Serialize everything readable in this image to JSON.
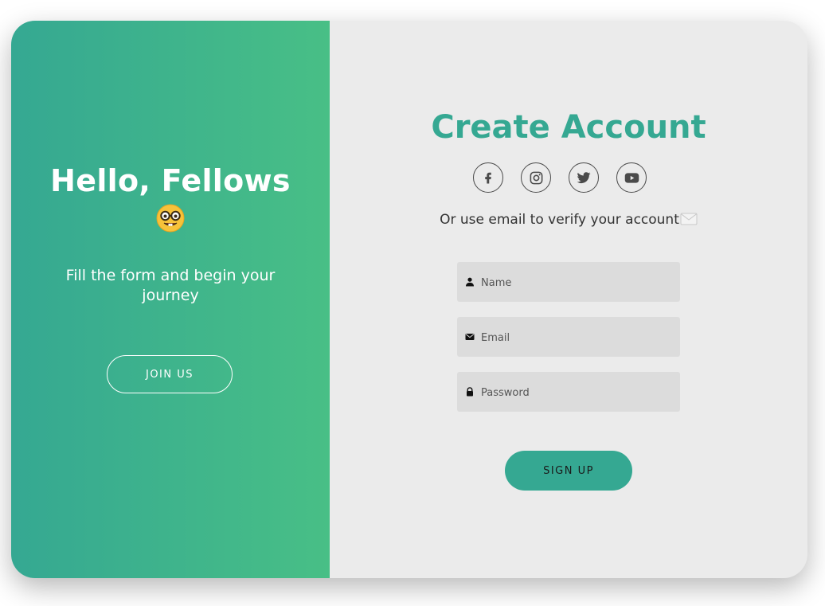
{
  "welcome": {
    "title": "Hello, Fellows",
    "emoji_icon": "nerd-face-icon",
    "subtitle": "Fill the form and begin your journey",
    "join_label": "JOIN US"
  },
  "signup": {
    "title": "Create Account",
    "social": [
      {
        "icon": "facebook-icon"
      },
      {
        "icon": "instagram-icon"
      },
      {
        "icon": "twitter-icon"
      },
      {
        "icon": "youtube-icon"
      }
    ],
    "helper_text": "Or use email to verify your account",
    "helper_icon": "envelope-icon",
    "fields": {
      "name": {
        "placeholder": "Name",
        "value": "",
        "icon": "user-icon"
      },
      "email": {
        "placeholder": "Email",
        "value": "",
        "icon": "envelope-icon"
      },
      "password": {
        "placeholder": "Password",
        "value": "",
        "icon": "lock-icon"
      }
    },
    "submit_label": "SIGN UP"
  },
  "colors": {
    "accent": "#35a892",
    "gradient_start": "#35a892",
    "gradient_end": "#48bf86",
    "panel_bg": "#ebebeb",
    "field_bg": "#dcdcdc"
  }
}
